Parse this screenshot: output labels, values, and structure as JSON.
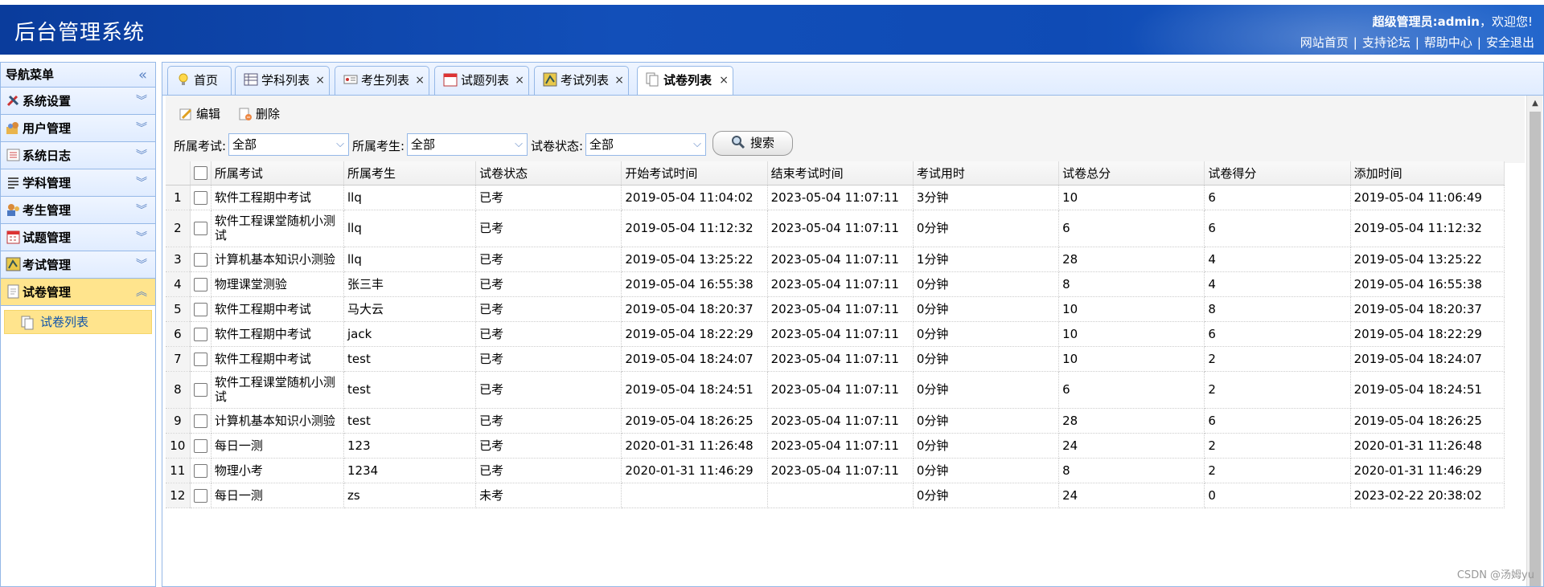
{
  "header": {
    "title": "后台管理系统",
    "welcome_user": "超级管理员:admin",
    "welcome_text": "，欢迎您!",
    "links": [
      "网站首页",
      "支持论坛",
      "帮助中心",
      "安全退出"
    ],
    "separator": "|"
  },
  "sidebar": {
    "title": "导航菜单",
    "collapse_icon": "«",
    "items": [
      {
        "label": "系统设置",
        "icon": "tools-icon"
      },
      {
        "label": "用户管理",
        "icon": "users-icon"
      },
      {
        "label": "系统日志",
        "icon": "log-icon"
      },
      {
        "label": "学科管理",
        "icon": "list-icon"
      },
      {
        "label": "考生管理",
        "icon": "students-icon"
      },
      {
        "label": "试题管理",
        "icon": "calendar-icon"
      },
      {
        "label": "考试管理",
        "icon": "exam-icon"
      },
      {
        "label": "试卷管理",
        "icon": "paper-icon"
      }
    ],
    "active_index": 7,
    "sub_item": "试卷列表",
    "chevron_down": "︾",
    "chevron_up": "︽"
  },
  "tabs": [
    {
      "label": "首页",
      "icon": "bulb-icon",
      "closable": false
    },
    {
      "label": "学科列表",
      "icon": "grid-icon",
      "closable": true
    },
    {
      "label": "考生列表",
      "icon": "card-icon",
      "closable": true
    },
    {
      "label": "试题列表",
      "icon": "calendar-icon",
      "closable": true
    },
    {
      "label": "考试列表",
      "icon": "exam-icon",
      "closable": true
    },
    {
      "label": "试卷列表",
      "icon": "paper-icon",
      "closable": true
    }
  ],
  "tab_close": "×",
  "selected_tab": 5,
  "toolbar": {
    "edit_label": "编辑",
    "delete_label": "删除",
    "filter_exam_label": "所属考试:",
    "filter_exam_value": "全部",
    "filter_student_label": "所属考生:",
    "filter_student_value": "全部",
    "filter_status_label": "试卷状态:",
    "filter_status_value": "全部",
    "combo_arrow": "⌵",
    "search_label": "搜索"
  },
  "table": {
    "columns": [
      "所属考试",
      "所属考生",
      "试卷状态",
      "开始考试时间",
      "结束考试时间",
      "考试用时",
      "试卷总分",
      "试卷得分",
      "添加时间"
    ],
    "rows": [
      [
        "1",
        "软件工程期中考试",
        "llq",
        "已考",
        "2019-05-04 11:04:02",
        "2023-05-04 11:07:11",
        "3分钟",
        "10",
        "6",
        "2019-05-04 11:06:49"
      ],
      [
        "2",
        "软件工程课堂随机小测试",
        "llq",
        "已考",
        "2019-05-04 11:12:32",
        "2023-05-04 11:07:11",
        "0分钟",
        "6",
        "6",
        "2019-05-04 11:12:32"
      ],
      [
        "3",
        "计算机基本知识小测验",
        "llq",
        "已考",
        "2019-05-04 13:25:22",
        "2023-05-04 11:07:11",
        "1分钟",
        "28",
        "4",
        "2019-05-04 13:25:22"
      ],
      [
        "4",
        "物理课堂测验",
        "张三丰",
        "已考",
        "2019-05-04 16:55:38",
        "2023-05-04 11:07:11",
        "0分钟",
        "8",
        "4",
        "2019-05-04 16:55:38"
      ],
      [
        "5",
        "软件工程期中考试",
        "马大云",
        "已考",
        "2019-05-04 18:20:37",
        "2023-05-04 11:07:11",
        "0分钟",
        "10",
        "8",
        "2019-05-04 18:20:37"
      ],
      [
        "6",
        "软件工程期中考试",
        "jack",
        "已考",
        "2019-05-04 18:22:29",
        "2023-05-04 11:07:11",
        "0分钟",
        "10",
        "6",
        "2019-05-04 18:22:29"
      ],
      [
        "7",
        "软件工程期中考试",
        "test",
        "已考",
        "2019-05-04 18:24:07",
        "2023-05-04 11:07:11",
        "0分钟",
        "10",
        "2",
        "2019-05-04 18:24:07"
      ],
      [
        "8",
        "软件工程课堂随机小测试",
        "test",
        "已考",
        "2019-05-04 18:24:51",
        "2023-05-04 11:07:11",
        "0分钟",
        "6",
        "2",
        "2019-05-04 18:24:51"
      ],
      [
        "9",
        "计算机基本知识小测验",
        "test",
        "已考",
        "2019-05-04 18:26:25",
        "2023-05-04 11:07:11",
        "0分钟",
        "28",
        "6",
        "2019-05-04 18:26:25"
      ],
      [
        "10",
        "每日一测",
        "123",
        "已考",
        "2020-01-31 11:26:48",
        "2023-05-04 11:07:11",
        "0分钟",
        "24",
        "2",
        "2020-01-31 11:26:48"
      ],
      [
        "11",
        "物理小考",
        "1234",
        "已考",
        "2020-01-31 11:46:29",
        "2023-05-04 11:07:11",
        "0分钟",
        "8",
        "2",
        "2020-01-31 11:46:29"
      ],
      [
        "12",
        "每日一测",
        "zs",
        "未考",
        "",
        "",
        "0分钟",
        "24",
        "0",
        "2023-02-22 20:38:02"
      ]
    ]
  },
  "scroll_up": "▲",
  "watermark": "CSDN @汤姆yu"
}
